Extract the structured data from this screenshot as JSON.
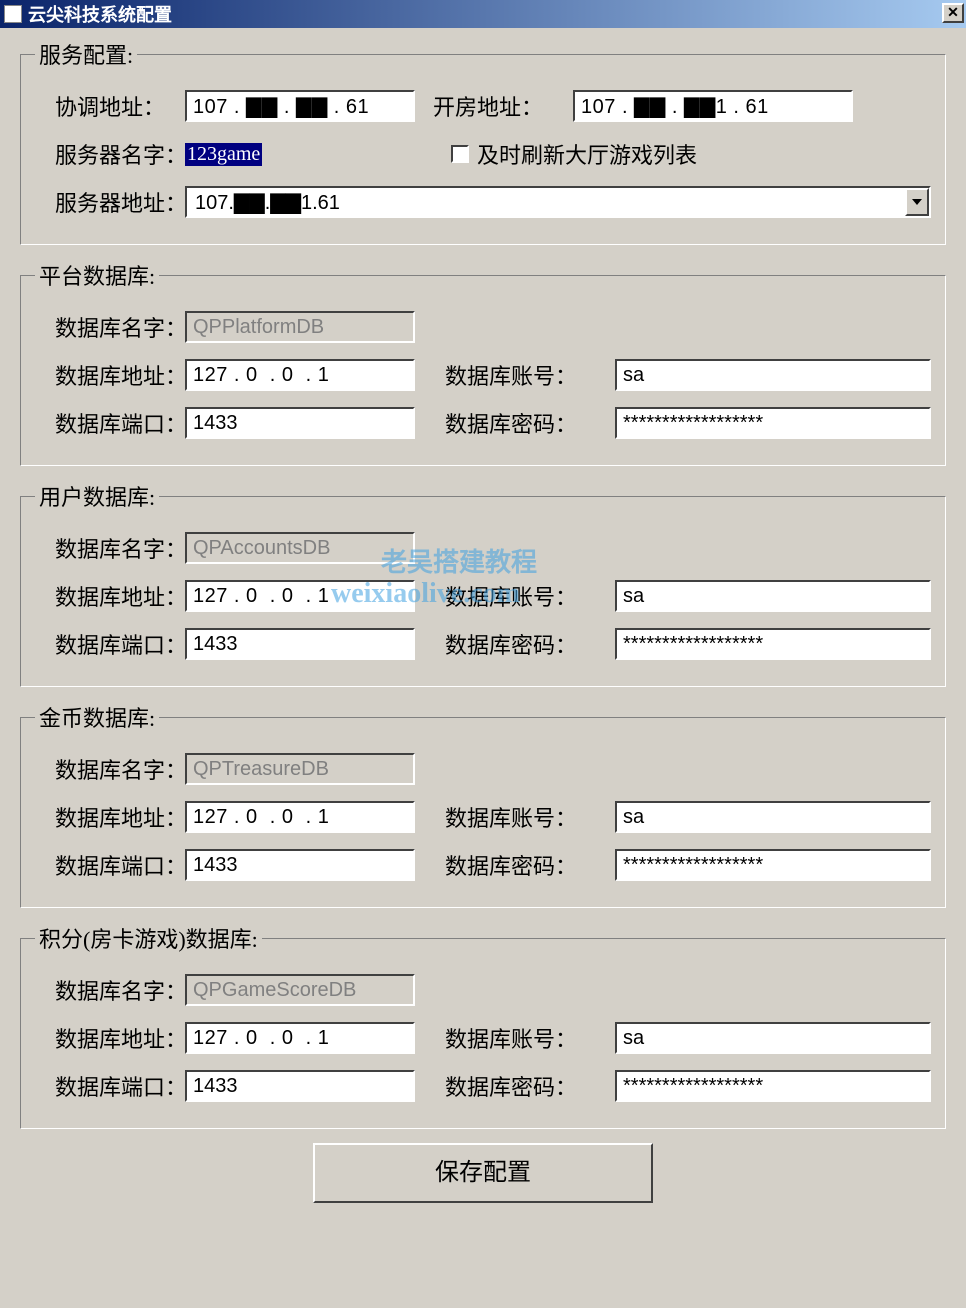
{
  "window": {
    "title": "云尖科技系统配置",
    "close_glyph": "✕"
  },
  "service": {
    "legend": "服务配置:",
    "coord_label": "协调地址：",
    "coord_value": "107 . ▇▇ . ▇▇ . 61",
    "room_label": "开房地址：",
    "room_value": "107 . ▇▇ . ▇▇1 . 61",
    "servername_label": "服务器名字：",
    "servername_value": "123game",
    "refresh_label": "及时刷新大厅游戏列表",
    "serveraddr_label": "服务器地址：",
    "serveraddr_value": "107.▇▇.▇▇1.61"
  },
  "platform_db": {
    "legend": "平台数据库:",
    "name_label": "数据库名字：",
    "name_value": "QPPlatformDB",
    "addr_label": "数据库地址：",
    "addr_value": "127 . 0  . 0  . 1",
    "acct_label": "数据库账号：",
    "acct_value": "sa",
    "port_label": "数据库端口：",
    "port_value": "1433",
    "pass_label": "数据库密码：",
    "pass_value": "******************"
  },
  "accounts_db": {
    "legend": "用户数据库:",
    "name_label": "数据库名字：",
    "name_value": "QPAccountsDB",
    "addr_label": "数据库地址：",
    "addr_value": "127 . 0  . 0  . 1",
    "acct_label": "数据库账号：",
    "acct_value": "sa",
    "port_label": "数据库端口：",
    "port_value": "1433",
    "pass_label": "数据库密码：",
    "pass_value": "******************"
  },
  "treasure_db": {
    "legend": "金币数据库:",
    "name_label": "数据库名字：",
    "name_value": "QPTreasureDB",
    "addr_label": "数据库地址：",
    "addr_value": "127 . 0  . 0  . 1",
    "acct_label": "数据库账号：",
    "acct_value": "sa",
    "port_label": "数据库端口：",
    "port_value": "1433",
    "pass_label": "数据库密码：",
    "pass_value": "******************"
  },
  "score_db": {
    "legend": "积分(房卡游戏)数据库:",
    "name_label": "数据库名字：",
    "name_value": "QPGameScoreDB",
    "addr_label": "数据库地址：",
    "addr_value": "127 . 0  . 0  . 1",
    "acct_label": "数据库账号：",
    "acct_value": "sa",
    "port_label": "数据库端口：",
    "port_value": "1433",
    "pass_label": "数据库密码：",
    "pass_value": "******************"
  },
  "footer": {
    "save_label": "保存配置"
  },
  "watermark": {
    "line1": "老吴搭建教程",
    "line2": "weixiaolive.com"
  }
}
